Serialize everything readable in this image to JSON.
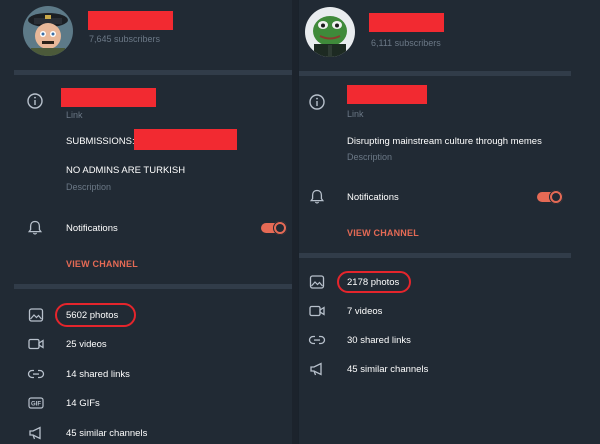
{
  "left": {
    "subscribers": "7,645 subscribers",
    "link_label": "Link",
    "submissions_label": "SUBMISSIONS:",
    "description_text": "NO ADMINS ARE TURKISH",
    "description_label": "Description",
    "notifications_label": "Notifications",
    "notifications_on": true,
    "view_channel": "VIEW CHANNEL",
    "media": [
      {
        "icon": "photo-icon",
        "label": "5602 photos"
      },
      {
        "icon": "video-icon",
        "label": "25 videos"
      },
      {
        "icon": "link-icon",
        "label": "14 shared links"
      },
      {
        "icon": "gif-icon",
        "label": "14 GIFs"
      },
      {
        "icon": "megaphone-icon",
        "label": "45 similar channels"
      }
    ]
  },
  "right": {
    "subscribers": "6,111 subscribers",
    "link_label": "Link",
    "description_text": "Disrupting mainstream culture through memes",
    "description_label": "Description",
    "notifications_label": "Notifications",
    "notifications_on": true,
    "view_channel": "VIEW CHANNEL",
    "media": [
      {
        "icon": "photo-icon",
        "label": "2178 photos"
      },
      {
        "icon": "video-icon",
        "label": "7 videos"
      },
      {
        "icon": "link-icon",
        "label": "30 shared links"
      },
      {
        "icon": "megaphone-icon",
        "label": "45 similar channels"
      }
    ]
  },
  "colors": {
    "background": "#212a34",
    "separator": "#313c49",
    "accent": "#e56a55",
    "redaction": "#f22a31",
    "highlight_oval": "#e5252c"
  }
}
